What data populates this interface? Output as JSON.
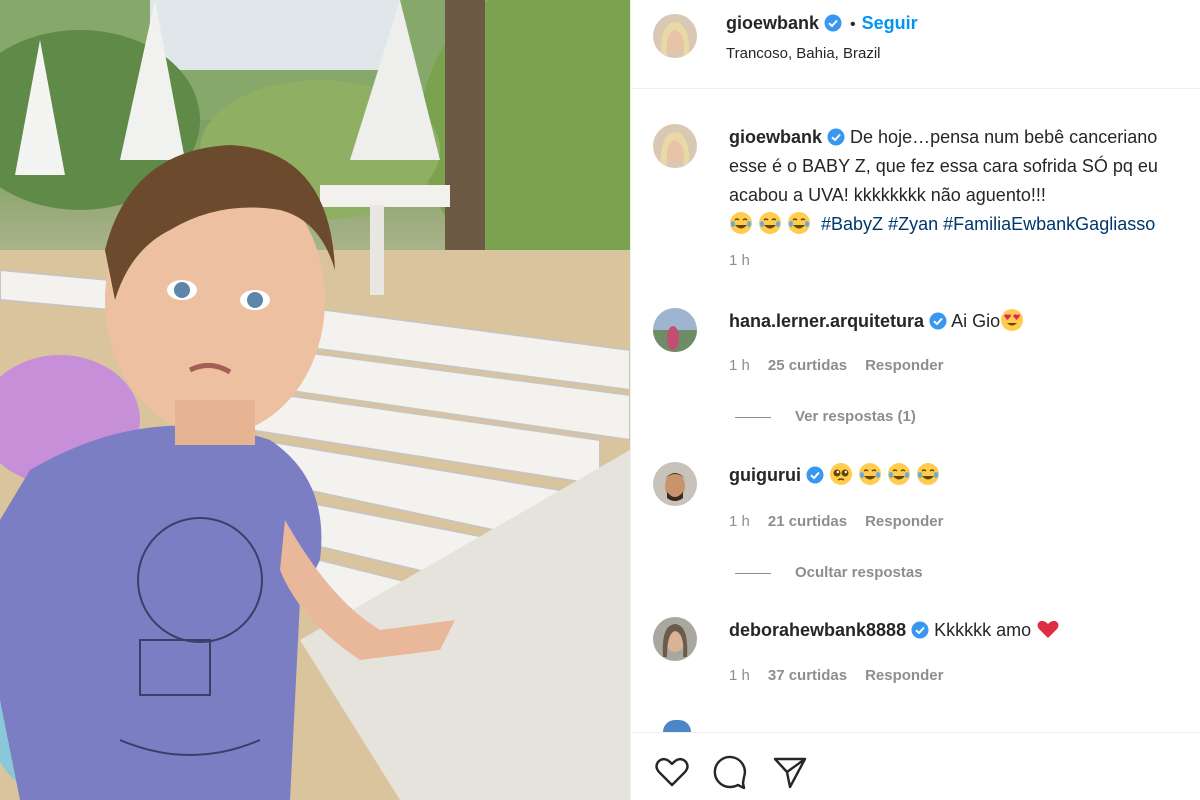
{
  "post": {
    "author": "gioewbank",
    "follow_label": "Seguir",
    "dot": "•",
    "location": "Trancoso, Bahia, Brazil"
  },
  "caption": {
    "username": "gioewbank",
    "line1": "De hoje…pensa num bebê canceriano",
    "line2": "esse é o BABY Z, que fez essa cara sofrida SÓ pq eu",
    "line3": "acabou a UVA! kkkkkkkk não aguento!!!",
    "hashtags": [
      "#BabyZ",
      "#Zyan",
      "#FamiliaEwbankGagliasso"
    ],
    "time": "1 h"
  },
  "comments": [
    {
      "username": "hana.lerner.arquitetura",
      "text": "Ai Gio",
      "emojis": [
        "heart-eyes-emoji"
      ],
      "time": "1 h",
      "likes": "25 curtidas",
      "reply_label": "Responder",
      "thread_label": "Ver respostas (1)"
    },
    {
      "username": "guigurui",
      "text": "",
      "emojis": [
        "pleading-face-emoji",
        "tears-of-joy-emoji",
        "tears-of-joy-emoji",
        "tears-of-joy-emoji"
      ],
      "time": "1 h",
      "likes": "21 curtidas",
      "reply_label": "Responder",
      "thread_label": "Ocultar respostas"
    },
    {
      "username": "deborahewbank8888",
      "text": "Kkkkkk amo",
      "emojis": [
        "red-heart-emoji"
      ],
      "time": "1 h",
      "likes": "37 curtidas",
      "reply_label": "Responder"
    }
  ],
  "actions": [
    "heart-icon",
    "comment-icon",
    "share-icon"
  ],
  "colors": {
    "link": "#0095f6",
    "hashtag": "#00376b",
    "muted": "#8e8e8e",
    "verified": "#3897f0"
  }
}
